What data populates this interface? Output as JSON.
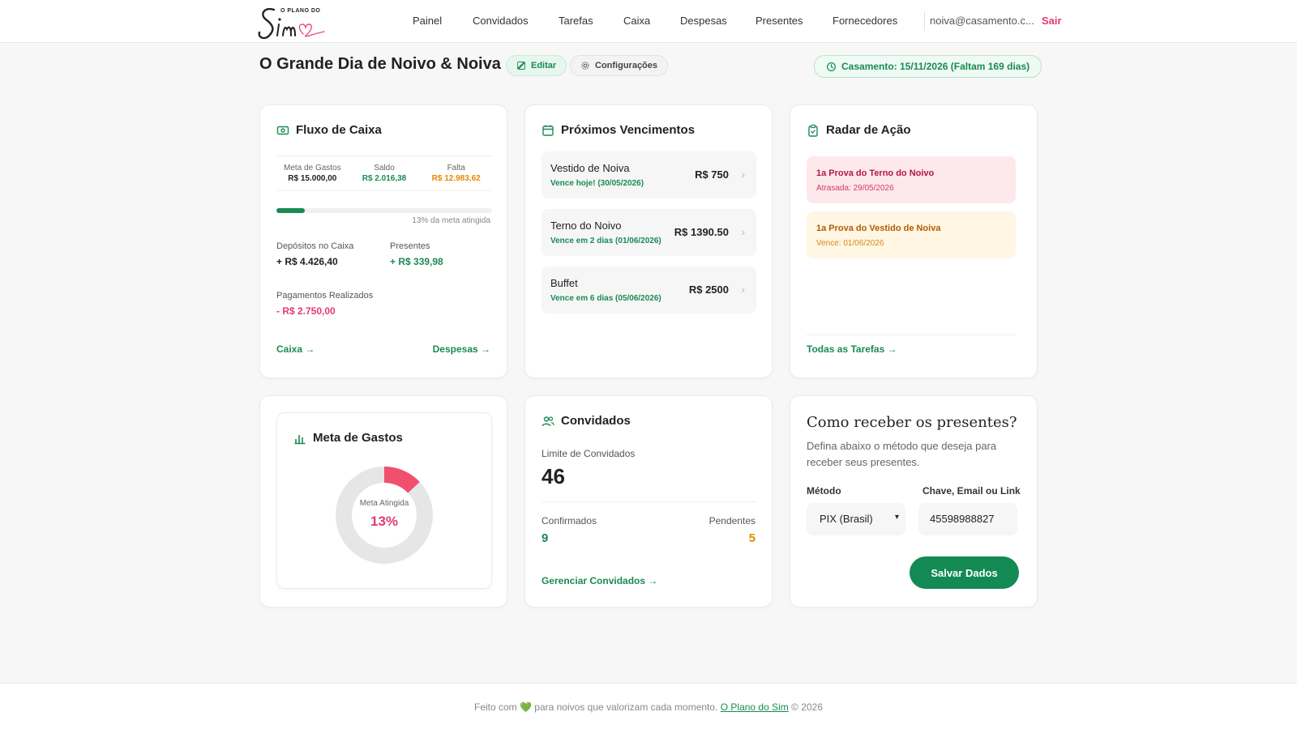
{
  "brand": {
    "small": "O PLANO DO",
    "big": "Sim"
  },
  "nav": {
    "items": [
      "Painel",
      "Convidados",
      "Tarefas",
      "Caixa",
      "Despesas",
      "Presentes",
      "Fornecedores"
    ],
    "email": "noiva@casamento.c...",
    "logout": "Sair"
  },
  "header": {
    "title": "O Grande Dia de Noivo & Noiva",
    "edit": "Editar",
    "config": "Configurações",
    "date": "Casamento: 15/11/2026 (Faltam 169 dias)"
  },
  "fluxo": {
    "title": "Fluxo de Caixa",
    "meta_label": "Meta de Gastos",
    "meta_value": "R$ 15.000,00",
    "saldo_label": "Saldo",
    "saldo_value": "R$ 2.016,38",
    "falta_label": "Falta",
    "falta_value": "R$ 12.983,62",
    "progress": 0.13,
    "progress_note": "13% da meta atingida",
    "depositos_label": "Depósitos no Caixa",
    "depositos_value": "+ R$ 4.426,40",
    "presentes_label": "Presentes",
    "presentes_value": "+ R$ 339,98",
    "pagamentos_label": "Pagamentos Realizados",
    "pagamentos_value": "- R$ 2.750,00",
    "link_caixa": "Caixa →",
    "link_despesas": "Despesas →"
  },
  "vencimentos": {
    "title": "Próximos Vencimentos",
    "items": [
      {
        "name": "Vestido de Noiva",
        "due": "Vence hoje! (30/05/2026)",
        "amount": "R$ 750"
      },
      {
        "name": "Terno do Noivo",
        "due": "Vence em 2 dias (01/06/2026)",
        "amount": "R$ 1390.50"
      },
      {
        "name": "Buffet",
        "due": "Vence em 6 dias (05/06/2026)",
        "amount": "R$ 2500"
      }
    ]
  },
  "radar": {
    "title": "Radar de Ação",
    "items": [
      {
        "name": "1a Prova do Terno do Noivo",
        "sub": "Atrasada: 29/05/2026"
      },
      {
        "name": "1a Prova do Vestido de Noiva",
        "sub": "Vence: 01/06/2026"
      }
    ],
    "link": "Todas as Tarefas →"
  },
  "meta": {
    "title": "Meta de Gastos",
    "donut_label": "Meta Atingida",
    "donut_value": "13%",
    "fraction": 0.13,
    "colors": {
      "fill": "#f0506e",
      "track": "#e6e6e6"
    }
  },
  "convidados": {
    "title": "Convidados",
    "limit_label": "Limite de Convidados",
    "limit_value": "46",
    "confirmed_label": "Confirmados",
    "confirmed_value": "9",
    "pending_label": "Pendentes",
    "pending_value": "5",
    "link": "Gerenciar Convidados →"
  },
  "presentes": {
    "title": "Como receber os presentes?",
    "desc": "Defina abaixo o método que deseja para receber seus presentes.",
    "method_label": "Método",
    "method_value": "PIX (Brasil)",
    "key_label": "Chave, Email ou Link",
    "key_value": "45598988827",
    "save": "Salvar Dados"
  },
  "footer": {
    "before": "Feito com 💚 para noivos que valorizam cada momento. ",
    "link": "O Plano do Sim",
    "after": " © 2026"
  },
  "colors": {
    "accent": "#1a8a55",
    "danger": "#e33b6e",
    "warning": "#e68a00"
  }
}
